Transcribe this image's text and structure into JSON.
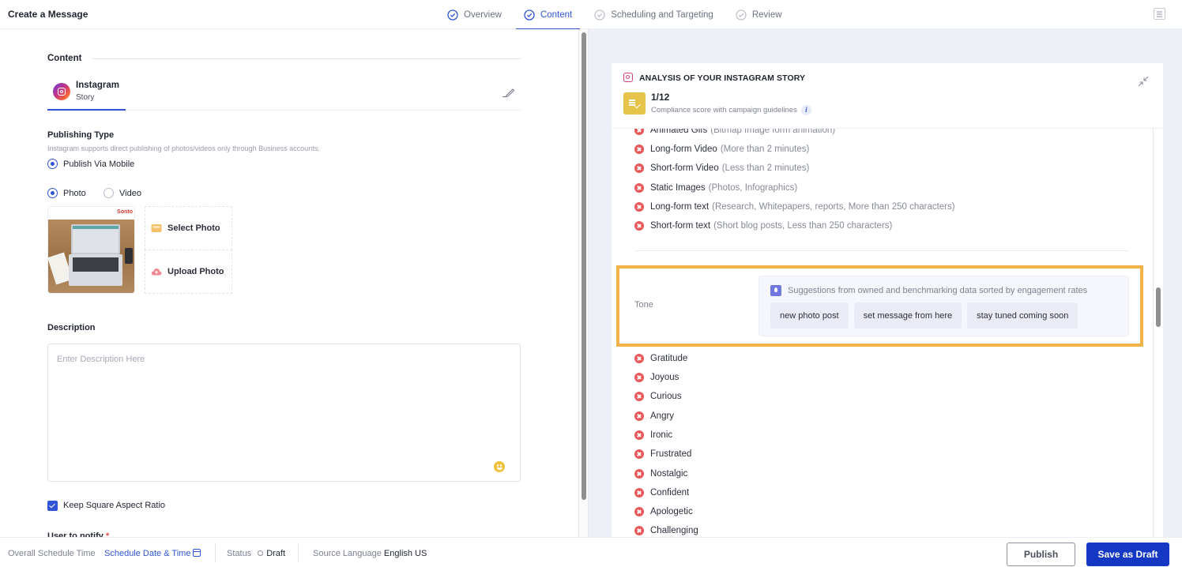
{
  "header": {
    "title": "Create a Message",
    "steps": [
      {
        "label": "Overview",
        "state": "done"
      },
      {
        "label": "Content",
        "state": "active"
      },
      {
        "label": "Scheduling and Targeting",
        "state": "pending"
      },
      {
        "label": "Review",
        "state": "pending"
      }
    ],
    "notes_icon": "notes-icon"
  },
  "content": {
    "section_title": "Content",
    "channel": {
      "name": "Instagram",
      "type": "Story",
      "icon": "instagram-icon"
    },
    "publishing_type": {
      "label": "Publishing Type",
      "hint": "Instagram supports direct publishing of photos/videos only through Business accounts.",
      "option": "Publish Via Mobile",
      "selected": true
    },
    "media_type": {
      "options": [
        {
          "label": "Photo",
          "selected": true
        },
        {
          "label": "Video",
          "selected": false
        }
      ]
    },
    "thumbnail": {
      "brand": "Sonto"
    },
    "media_actions": {
      "select": "Select Photo",
      "upload": "Upload Photo"
    },
    "description": {
      "label": "Description",
      "placeholder": "Enter Description Here",
      "value": ""
    },
    "keep_square": {
      "label": "Keep Square Aspect Ratio",
      "checked": true
    },
    "user_to_notify": {
      "label": "User to notify",
      "required_marker": "*"
    }
  },
  "analysis": {
    "title": "ANALYSIS OF YOUR INSTAGRAM STORY",
    "score": "1/12",
    "score_desc": "Compliance score with campaign guidelines",
    "info_glyph": "i",
    "format_items": [
      {
        "label": "Animated Gifs",
        "detail": "(Bitmap Image form animation)",
        "status": "fail"
      },
      {
        "label": "Long-form Video",
        "detail": "(More than 2 minutes)",
        "status": "fail"
      },
      {
        "label": "Short-form Video",
        "detail": "(Less than 2 minutes)",
        "status": "fail"
      },
      {
        "label": "Static Images",
        "detail": "(Photos, Infographics)",
        "status": "fail"
      },
      {
        "label": "Long-form text",
        "detail": "(Research, Whitepapers, reports, More than 250 characters)",
        "status": "fail"
      },
      {
        "label": "Short-form text",
        "detail": "(Short blog posts, Less than 250 characters)",
        "status": "fail"
      }
    ],
    "tone": {
      "label": "Tone",
      "suggestion_header": "Suggestions from owned and benchmarking data sorted by engagement rates",
      "suggestions": [
        "new photo post",
        "set message from here",
        "stay tuned coming soon"
      ],
      "highlight_color": "#f2b24b"
    },
    "tone_items": [
      {
        "label": "Gratitude",
        "status": "fail"
      },
      {
        "label": "Joyous",
        "status": "fail"
      },
      {
        "label": "Curious",
        "status": "fail"
      },
      {
        "label": "Angry",
        "status": "fail"
      },
      {
        "label": "Ironic",
        "status": "fail"
      },
      {
        "label": "Frustrated",
        "status": "fail"
      },
      {
        "label": "Nostalgic",
        "status": "fail"
      },
      {
        "label": "Confident",
        "status": "fail"
      },
      {
        "label": "Apologetic",
        "status": "fail"
      },
      {
        "label": "Challenging",
        "status": "fail"
      }
    ]
  },
  "footer": {
    "schedule_label": "Overall Schedule Time",
    "schedule_link": "Schedule Date & Time",
    "status_label": "Status",
    "status_value": "Draft",
    "language_label": "Source Language",
    "language_value": "English US",
    "publish_button": "Publish",
    "draft_button": "Save as Draft"
  },
  "colors": {
    "accent": "#2f54d6",
    "primary_button": "#1538c4",
    "fail": "#e8585a",
    "score_badge": "#e6c44a"
  }
}
